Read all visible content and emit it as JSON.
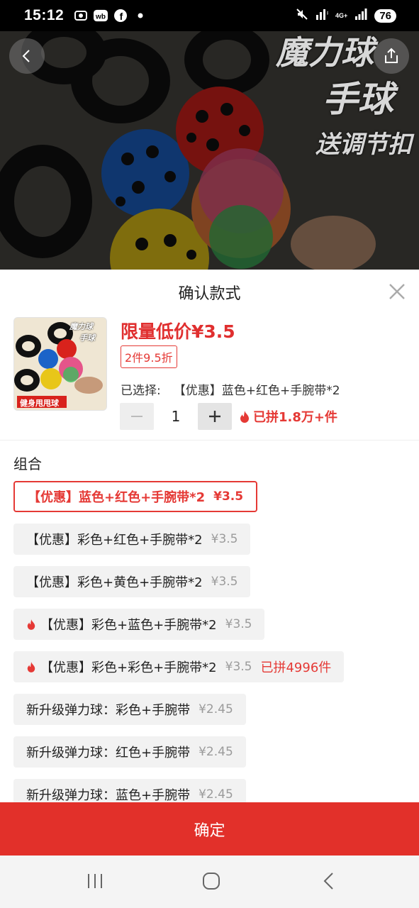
{
  "status_bar": {
    "time": "15:12",
    "battery": "76",
    "net_top": "4G+",
    "left_icons": [
      "screenshot-icon",
      "weibo-icon",
      "facebook-icon",
      "dot-icon"
    ],
    "right_icons": [
      "mute-icon",
      "signal-r-icon",
      "4g-icon",
      "signal-icon"
    ]
  },
  "hero": {
    "text_line1": "魔力球",
    "text_line2": "手球",
    "text_line3": "送调节扣"
  },
  "sheet": {
    "title": "确认款式",
    "thumbnail": {
      "title_line1": "魔力球",
      "title_line2": "手球",
      "caption": "健身甩甩球"
    },
    "price": "限量低价¥3.5",
    "discount": "2件9.5折",
    "selected_label": "已选择:",
    "selected_value": "【优惠】蓝色+红色+手腕带*2",
    "quantity": "1",
    "sold": "已拼1.8万+件",
    "group_label": "组合",
    "options": [
      {
        "label": "【优惠】蓝色+红色+手腕带*2",
        "price": "¥3.5",
        "active": true,
        "fire": false,
        "sold": ""
      },
      {
        "label": "【优惠】彩色+红色+手腕带*2",
        "price": "¥3.5",
        "active": false,
        "fire": false,
        "sold": ""
      },
      {
        "label": "【优惠】彩色+黄色+手腕带*2",
        "price": "¥3.5",
        "active": false,
        "fire": false,
        "sold": ""
      },
      {
        "label": "【优惠】彩色+蓝色+手腕带*2",
        "price": "¥3.5",
        "active": false,
        "fire": true,
        "sold": ""
      },
      {
        "label": "【优惠】彩色+彩色+手腕带*2",
        "price": "¥3.5",
        "active": false,
        "fire": true,
        "sold": "已拼4996件"
      },
      {
        "label": "新升级弹力球：彩色+手腕带",
        "price": "¥2.45",
        "active": false,
        "fire": false,
        "sold": ""
      },
      {
        "label": "新升级弹力球：红色+手腕带",
        "price": "¥2.45",
        "active": false,
        "fire": false,
        "sold": ""
      },
      {
        "label": "新升级弹力球：蓝色+手腕带",
        "price": "¥2.45",
        "active": false,
        "fire": false,
        "sold": ""
      }
    ],
    "confirm_label": "确定"
  },
  "colors": {
    "accent": "#e53935",
    "confirm_bg": "#e2302a",
    "option_bg": "#f2f2f2"
  }
}
